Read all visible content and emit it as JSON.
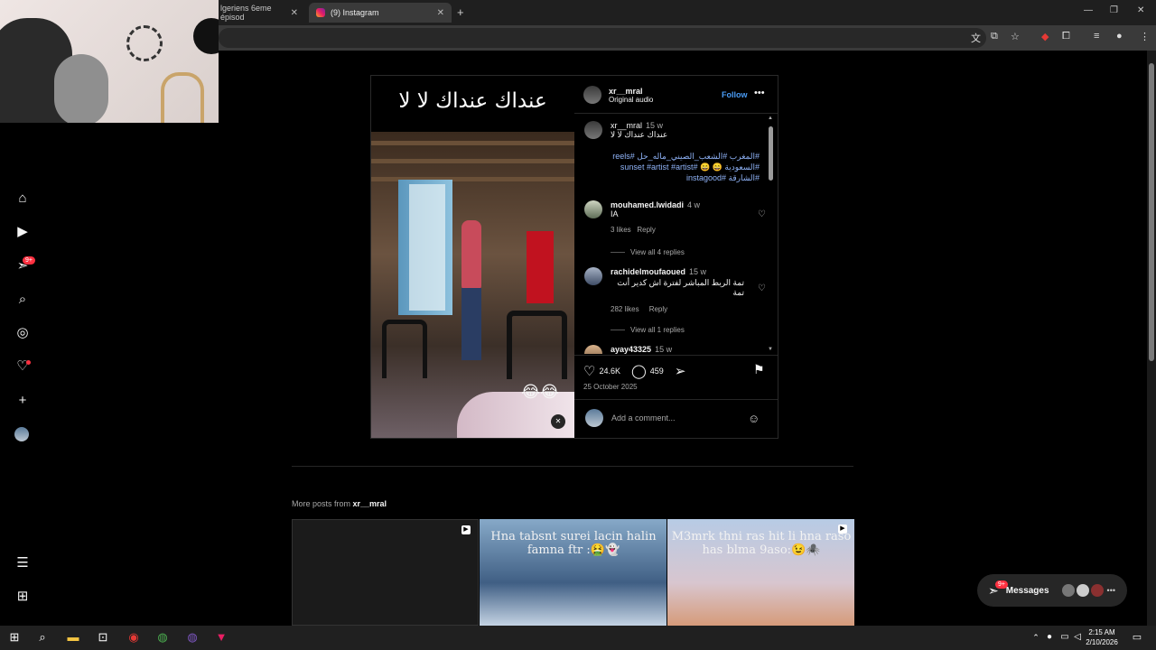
{
  "browser": {
    "tabs": [
      {
        "label": "lgeriens 6eme épisod",
        "active": false
      },
      {
        "label": "(9) Instagram",
        "active": true
      }
    ],
    "new_tab": "+",
    "window_controls": {
      "min": "—",
      "restore": "❐",
      "close": "✕"
    }
  },
  "sidebar": {
    "notification_count": "9+",
    "items": [
      "home-icon",
      "reels-icon",
      "messages-icon",
      "search-icon",
      "explore-icon",
      "notifications-icon",
      "create-icon",
      "profile-icon",
      "menu-icon",
      "more-icon"
    ]
  },
  "post": {
    "banner_text": "عنداك عنداك لا لا",
    "media_emoji": "😂😂",
    "author": "xr__mral",
    "audio": "Original audio",
    "follow": "Follow",
    "caption_user": "xr__mral",
    "caption_time": "15 w",
    "caption_text": "عنداك عنداك لا لا",
    "hashtags_line1": "#المغرب #الشعب_الصيني_ماله_حل #reels",
    "hashtags_line2": "#السعودية 😄 😄 #sunset #artist #artist",
    "hashtags_line3": "#الشارقة #instagood",
    "comments": [
      {
        "user": "mouhamed.lwidadi",
        "time": "4 w",
        "text": "IA",
        "likes": "3 likes",
        "reply": "Reply",
        "view": "View all 4 replies"
      },
      {
        "user": "rachidelmoufaoued",
        "time": "15 w",
        "text": "تمة الربط المباشر لفترة اش كدير أنت تمة",
        "likes": "282 likes",
        "reply": "Reply",
        "view": "View all 1 replies"
      },
      {
        "user": "ayay43325",
        "time": "15 w"
      }
    ],
    "likes": "24.6K",
    "comment_count": "459",
    "date": "25 October 2025",
    "add_comment_placeholder": "Add a comment..."
  },
  "more_posts": {
    "prefix": "More posts from ",
    "user": "xr__mral",
    "tiles": [
      {
        "text": ""
      },
      {
        "text": "Hna tabsnt surei lacin halin famna ftr :🤮👻"
      },
      {
        "text": "M3mrk thni ras hit li hna raso has blma 9aso:😉🕷️"
      }
    ]
  },
  "messages_button": {
    "label": "Messages",
    "badge": "9+"
  },
  "taskbar": {
    "time": "2:15 AM",
    "date": "2/10/2026"
  }
}
